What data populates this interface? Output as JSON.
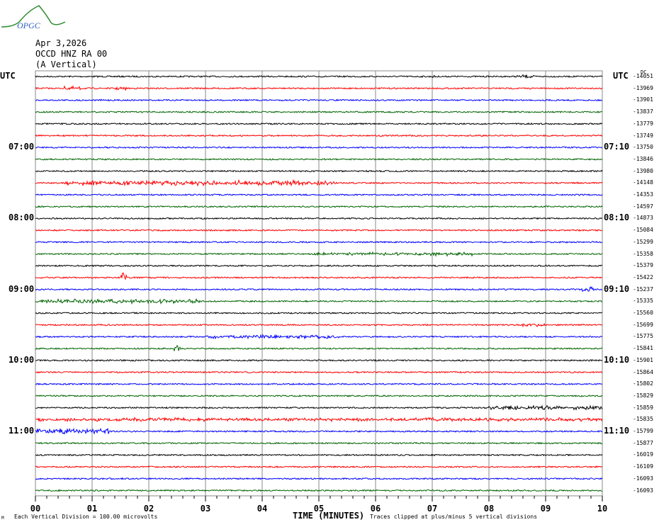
{
  "logo_text": "OPGC",
  "header": {
    "date": "Apr 3,2026",
    "station": "OCCD HNZ RA 00",
    "component": "(A Vertical)"
  },
  "left_utc_label": "UTC",
  "right_utc_label": "UTC",
  "dc_label": "DC",
  "chart_data": {
    "type": "line",
    "title": "OCCD HNZ RA 00 (A Vertical) Apr 3,2026",
    "xlabel": "TIME (MINUTES)",
    "xlim": [
      0,
      10
    ],
    "x_ticks": [
      "00",
      "01",
      "02",
      "03",
      "04",
      "05",
      "06",
      "07",
      "08",
      "09",
      "10"
    ],
    "trace_colors": [
      "#000000",
      "#ff0000",
      "#0000ff",
      "#006400"
    ],
    "rows": 36,
    "minutes_per_row": 10,
    "left_time_labels": [
      {
        "row": 6,
        "label": "07:00"
      },
      {
        "row": 12,
        "label": "08:00"
      },
      {
        "row": 18,
        "label": "09:00"
      },
      {
        "row": 24,
        "label": "10:00"
      },
      {
        "row": 30,
        "label": "11:00"
      }
    ],
    "right_time_labels": [
      {
        "row": 6,
        "label": "07:10"
      },
      {
        "row": 12,
        "label": "08:10"
      },
      {
        "row": 18,
        "label": "09:10"
      },
      {
        "row": 24,
        "label": "10:10"
      },
      {
        "row": 30,
        "label": "11:10"
      }
    ],
    "dc_offsets": [
      "-14051",
      "-13969",
      "-13901",
      "-13837",
      "-13779",
      "-13749",
      "-13750",
      "-13846",
      "-13980",
      "-14148",
      "-14353",
      "-14597",
      "-14873",
      "-15084",
      "-15299",
      "-15358",
      "-15379",
      "-15422",
      "-15237",
      "-15335",
      "-15560",
      "-15699",
      "-15775",
      "-15841",
      "-15901",
      "-15864",
      "-15802",
      "-15829",
      "-15859",
      "-15835",
      "-15799",
      "-15877",
      "-16019",
      "-16109",
      "-16093",
      "-16093"
    ],
    "events": [
      {
        "row": 0,
        "start": 6.9,
        "end": 7.1,
        "amp": 2
      },
      {
        "row": 0,
        "start": 8.5,
        "end": 8.8,
        "amp": 2.5
      },
      {
        "row": 1,
        "start": 0.5,
        "end": 0.8,
        "amp": 3
      },
      {
        "row": 1,
        "start": 1.4,
        "end": 1.6,
        "amp": 2.5
      },
      {
        "row": 9,
        "start": 0.5,
        "end": 5.3,
        "amp": 3.5
      },
      {
        "row": 15,
        "start": 4.9,
        "end": 7.7,
        "amp": 2.5
      },
      {
        "row": 17,
        "start": 1.5,
        "end": 1.6,
        "amp": 8
      },
      {
        "row": 18,
        "start": 9.65,
        "end": 9.85,
        "amp": 5
      },
      {
        "row": 19,
        "start": 0,
        "end": 2.9,
        "amp": 3
      },
      {
        "row": 21,
        "start": 8.6,
        "end": 9.0,
        "amp": 3
      },
      {
        "row": 22,
        "start": 3.0,
        "end": 5.4,
        "amp": 2.5
      },
      {
        "row": 23,
        "start": 2.45,
        "end": 2.55,
        "amp": 5
      },
      {
        "row": 28,
        "start": 8.0,
        "end": 10,
        "amp": 3
      },
      {
        "row": 29,
        "start": 0,
        "end": 10,
        "amp": 2.5
      },
      {
        "row": 30,
        "start": 0,
        "end": 1.3,
        "amp": 4
      }
    ]
  },
  "footer": {
    "mark": "M",
    "scale": "Each Vertical Division =  100.00 microvolts",
    "xlabel": "TIME (MINUTES)",
    "clip": "Traces clipped at plus/minus 5 vertical divisions"
  }
}
